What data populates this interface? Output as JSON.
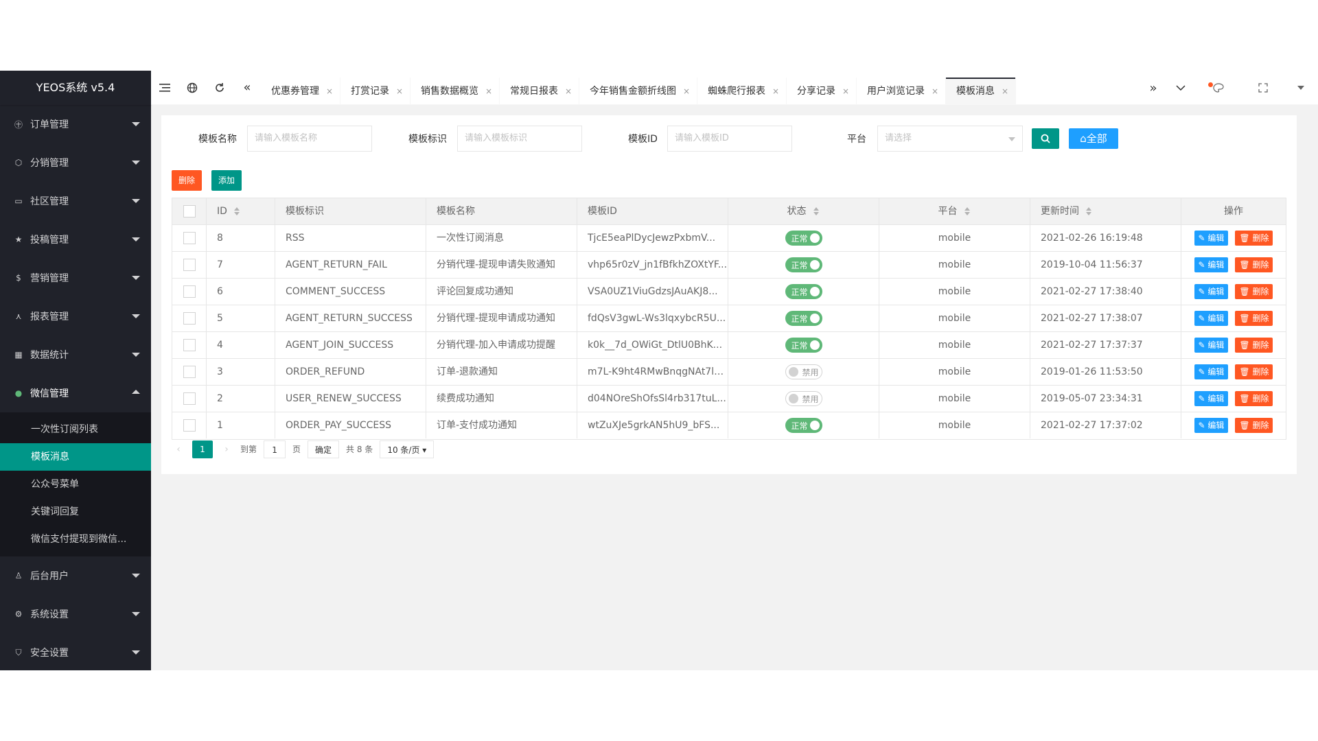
{
  "app": {
    "title": "YEOS系统 v5.4"
  },
  "sidebar": {
    "items": [
      {
        "label": "订单管理",
        "icon": "order-icon"
      },
      {
        "label": "分销管理",
        "icon": "distribution-icon"
      },
      {
        "label": "社区管理",
        "icon": "community-icon"
      },
      {
        "label": "投稿管理",
        "icon": "star-icon"
      },
      {
        "label": "营销管理",
        "icon": "coin-icon"
      },
      {
        "label": "报表管理",
        "icon": "report-icon"
      },
      {
        "label": "数据统计",
        "icon": "grid-icon"
      },
      {
        "label": "微信管理",
        "icon": "wechat-icon",
        "open": true
      },
      {
        "label": "后台用户",
        "icon": "user-icon"
      },
      {
        "label": "系统设置",
        "icon": "gear-icon"
      },
      {
        "label": "安全设置",
        "icon": "shield-icon"
      }
    ],
    "submenu": [
      {
        "label": "一次性订阅列表"
      },
      {
        "label": "模板消息",
        "active": true
      },
      {
        "label": "公众号菜单"
      },
      {
        "label": "关键词回复"
      },
      {
        "label": "微信支付提现到微信..."
      }
    ]
  },
  "topbar": {
    "tabs": [
      {
        "label": "优惠券管理"
      },
      {
        "label": "打赏记录"
      },
      {
        "label": "销售数据概览"
      },
      {
        "label": "常规日报表"
      },
      {
        "label": "今年销售金额折线图"
      },
      {
        "label": "蜘蛛爬行报表"
      },
      {
        "label": "分享记录"
      },
      {
        "label": "用户浏览记录"
      },
      {
        "label": "模板消息",
        "active": true
      }
    ],
    "close_glyph": "×"
  },
  "search": {
    "name_label": "模板名称",
    "name_placeholder": "请输入模板名称",
    "key_label": "模板标识",
    "key_placeholder": "请输入模板标识",
    "id_label": "模板ID",
    "id_placeholder": "请输入模板ID",
    "platform_label": "平台",
    "platform_placeholder": "请选择",
    "all_label": "⌂全部"
  },
  "actions": {
    "delete_label": "删除",
    "add_label": "添加"
  },
  "table": {
    "headers": [
      "ID",
      "模板标识",
      "模板名称",
      "模板ID",
      "状态",
      "平台",
      "更新时间",
      "操作"
    ],
    "rows": [
      {
        "id": "8",
        "key": "RSS",
        "name": "一次性订阅消息",
        "tid": "TjcE5eaPlDycJewzPxbmV...",
        "status": "正常",
        "on": true,
        "platform": "mobile",
        "time": "2021-02-26 16:19:48"
      },
      {
        "id": "7",
        "key": "AGENT_RETURN_FAIL",
        "name": "分销代理-提现申请失败通知",
        "tid": "vhp65r0zV_jn1fBfkhZOXtYF...",
        "status": "正常",
        "on": true,
        "platform": "mobile",
        "time": "2019-10-04 11:56:37"
      },
      {
        "id": "6",
        "key": "COMMENT_SUCCESS",
        "name": "评论回复成功通知",
        "tid": "VSA0UZ1ViuGdzsJAuAKJ8...",
        "status": "正常",
        "on": true,
        "platform": "mobile",
        "time": "2021-02-27 17:38:40"
      },
      {
        "id": "5",
        "key": "AGENT_RETURN_SUCCESS",
        "name": "分销代理-提现申请成功通知",
        "tid": "fdQsV3gwL-Ws3lqxybcR5U...",
        "status": "正常",
        "on": true,
        "platform": "mobile",
        "time": "2021-02-27 17:38:07"
      },
      {
        "id": "4",
        "key": "AGENT_JOIN_SUCCESS",
        "name": "分销代理-加入申请成功提醒",
        "tid": "k0k__7d_OWiGt_DtlU0BhK...",
        "status": "正常",
        "on": true,
        "platform": "mobile",
        "time": "2021-02-27 17:37:37"
      },
      {
        "id": "3",
        "key": "ORDER_REFUND",
        "name": "订单-退款通知",
        "tid": "m7L-K9ht4RMwBnqgNAt7lZ...",
        "status": "禁用",
        "on": false,
        "platform": "mobile",
        "time": "2019-01-26 11:53:50"
      },
      {
        "id": "2",
        "key": "USER_RENEW_SUCCESS",
        "name": "续费成功通知",
        "tid": "d04NOreShOfsSl4rb317tuL...",
        "status": "禁用",
        "on": false,
        "platform": "mobile",
        "time": "2019-05-07 23:34:31"
      },
      {
        "id": "1",
        "key": "ORDER_PAY_SUCCESS",
        "name": "订单-支付成功通知",
        "tid": "wtZuXJe5grkAN5hU9_bFS...",
        "status": "正常",
        "on": true,
        "platform": "mobile",
        "time": "2021-02-27 17:37:02"
      }
    ],
    "edit_label": "✎ 编辑",
    "delete_label": "🗑 删除"
  },
  "pager": {
    "current": "1",
    "goto_label": "到第",
    "goto_value": "1",
    "page_unit": "页",
    "confirm_label": "确定",
    "total_label": "共 8 条",
    "size_label": "10 条/页 ▾"
  }
}
